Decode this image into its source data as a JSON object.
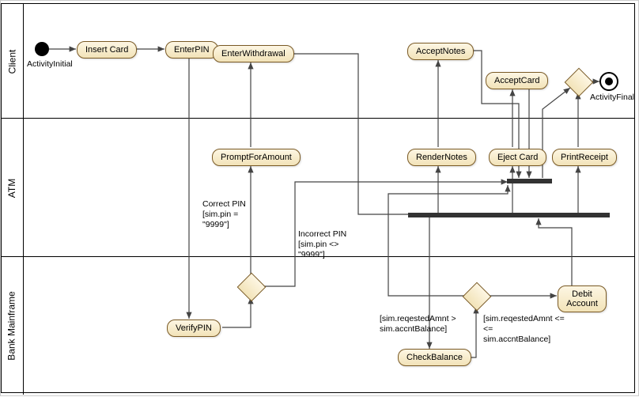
{
  "lanes": {
    "client": "Client",
    "atm": "ATM",
    "mainframe": "Bank Mainframe"
  },
  "nodes": {
    "activityInitial": "ActivityInitial",
    "insertCard": "Insert Card",
    "enterPIN": "EnterPIN",
    "enterWithdrawal": "EnterWithdrawal",
    "acceptNotes": "AcceptNotes",
    "acceptCard": "AcceptCard",
    "activityFinal": "ActivityFinal",
    "promptForAmount": "PromptForAmount",
    "renderNotes": "RenderNotes",
    "ejectCard": "Eject Card",
    "printReceipt": "PrintReceipt",
    "verifyPIN": "VerifyPIN",
    "checkBalance": "CheckBalance",
    "debitAccount": "Debit Account"
  },
  "guards": {
    "correctPIN_label": "Correct PIN",
    "correctPIN_cond": "[sim.pin = \"9999\"]",
    "incorrectPIN_label": "Incorrect PIN",
    "incorrectPIN_cond": "[sim.pin <> \"9999\"]",
    "balFail": "[sim.reqestedAmnt > sim.accntBalance]",
    "balOK1": "[sim.reqestedAmnt <=",
    "balOK2": "sim.accntBalance]"
  },
  "chart_data": {
    "type": "uml-activity-diagram",
    "swimlanes": [
      "Client",
      "ATM",
      "Bank Mainframe"
    ],
    "nodes": [
      {
        "id": "start",
        "type": "initial",
        "lane": "Client",
        "label": "ActivityInitial"
      },
      {
        "id": "insertCard",
        "type": "activity",
        "lane": "Client",
        "label": "Insert Card"
      },
      {
        "id": "enterPIN",
        "type": "activity",
        "lane": "Client",
        "label": "EnterPIN"
      },
      {
        "id": "enterWithdrawal",
        "type": "activity",
        "lane": "Client",
        "label": "EnterWithdrawal"
      },
      {
        "id": "acceptNotes",
        "type": "activity",
        "lane": "Client",
        "label": "AcceptNotes"
      },
      {
        "id": "acceptCard",
        "type": "activity",
        "lane": "Client",
        "label": "AcceptCard"
      },
      {
        "id": "mergeFinal",
        "type": "merge",
        "lane": "Client"
      },
      {
        "id": "end",
        "type": "final",
        "lane": "Client",
        "label": "ActivityFinal"
      },
      {
        "id": "promptForAmount",
        "type": "activity",
        "lane": "ATM",
        "label": "PromptForAmount"
      },
      {
        "id": "renderNotes",
        "type": "activity",
        "lane": "ATM",
        "label": "RenderNotes"
      },
      {
        "id": "ejectCard",
        "type": "activity",
        "lane": "ATM",
        "label": "Eject Card"
      },
      {
        "id": "printReceipt",
        "type": "activity",
        "lane": "ATM",
        "label": "PrintReceipt"
      },
      {
        "id": "join1",
        "type": "join",
        "lane": "ATM"
      },
      {
        "id": "fork1",
        "type": "fork",
        "lane": "ATM"
      },
      {
        "id": "verifyPIN",
        "type": "activity",
        "lane": "Bank Mainframe",
        "label": "VerifyPIN"
      },
      {
        "id": "pinDecision",
        "type": "decision",
        "lane": "Bank Mainframe"
      },
      {
        "id": "checkBalance",
        "type": "activity",
        "lane": "Bank Mainframe",
        "label": "CheckBalance"
      },
      {
        "id": "balanceDecision",
        "type": "decision",
        "lane": "Bank Mainframe"
      },
      {
        "id": "debitAccount",
        "type": "activity",
        "lane": "Bank Mainframe",
        "label": "Debit Account"
      }
    ],
    "edges": [
      {
        "from": "start",
        "to": "insertCard"
      },
      {
        "from": "insertCard",
        "to": "enterPIN"
      },
      {
        "from": "enterPIN",
        "to": "verifyPIN"
      },
      {
        "from": "verifyPIN",
        "to": "pinDecision"
      },
      {
        "from": "pinDecision",
        "to": "promptForAmount",
        "label": "Correct PIN",
        "guard": "sim.pin = \"9999\""
      },
      {
        "from": "pinDecision",
        "to": "join1",
        "label": "Incorrect PIN",
        "guard": "sim.pin <> \"9999\""
      },
      {
        "from": "promptForAmount",
        "to": "enterWithdrawal"
      },
      {
        "from": "enterWithdrawal",
        "to": "checkBalance"
      },
      {
        "from": "checkBalance",
        "to": "balanceDecision"
      },
      {
        "from": "balanceDecision",
        "to": "join1",
        "guard": "sim.reqestedAmnt > sim.accntBalance"
      },
      {
        "from": "balanceDecision",
        "to": "debitAccount",
        "guard": "sim.reqestedAmnt <= sim.accntBalance"
      },
      {
        "from": "debitAccount",
        "to": "fork1"
      },
      {
        "from": "fork1",
        "to": "renderNotes"
      },
      {
        "from": "fork1",
        "to": "ejectCard"
      },
      {
        "from": "fork1",
        "to": "printReceipt"
      },
      {
        "from": "renderNotes",
        "to": "acceptNotes"
      },
      {
        "from": "ejectCard",
        "to": "acceptCard"
      },
      {
        "from": "acceptNotes",
        "to": "join1"
      },
      {
        "from": "acceptCard",
        "to": "join1"
      },
      {
        "from": "printReceipt",
        "to": "mergeFinal"
      },
      {
        "from": "join1",
        "to": "mergeFinal"
      },
      {
        "from": "mergeFinal",
        "to": "end"
      }
    ]
  }
}
